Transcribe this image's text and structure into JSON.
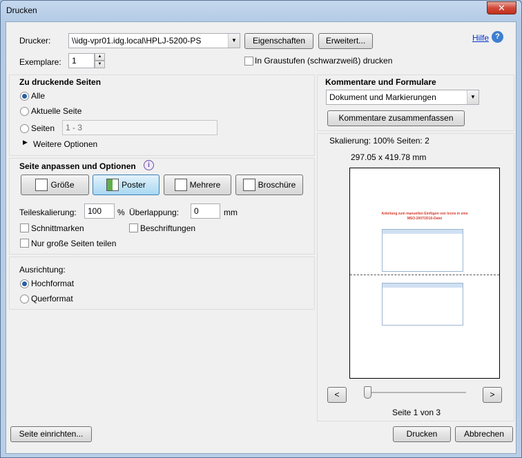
{
  "window": {
    "title": "Drucken",
    "close_label": "✕"
  },
  "printer": {
    "label": "Drucker:",
    "value": "\\\\idg-vpr01.idg.local\\HPLJ-5200-PS",
    "properties_button": "Eigenschaften",
    "advanced_button": "Erweitert...",
    "help_label": "Hilfe"
  },
  "copies": {
    "label": "Exemplare:",
    "value": "1"
  },
  "grayscale": {
    "label": "In Graustufen (schwarzweiß) drucken",
    "checked": false
  },
  "pages": {
    "title": "Zu druckende Seiten",
    "all": "Alle",
    "current": "Aktuelle Seite",
    "range": "Seiten",
    "range_placeholder": "1 - 3",
    "more_options": "Weitere Optionen"
  },
  "fit": {
    "title": "Seite anpassen und Optionen",
    "buttons": [
      "Größe",
      "Poster",
      "Mehrere",
      "Broschüre"
    ],
    "active": "Poster",
    "tile_scale_label": "Teileskalierung:",
    "tile_scale_value": "100",
    "tile_scale_unit": "%",
    "overlap_label": "Überlappung:",
    "overlap_value": "0",
    "overlap_unit": "mm",
    "cut_marks": "Schnittmarken",
    "labels": "Beschriftungen",
    "large_pages_only": "Nur große Seiten teilen"
  },
  "orientation": {
    "title": "Ausrichtung:",
    "portrait": "Hochformat",
    "landscape": "Querformat"
  },
  "comments": {
    "title": "Kommentare und Formulare",
    "select_value": "Dokument und Markierungen",
    "summarize_button": "Kommentare zusammenfassen"
  },
  "preview": {
    "scaling": "Skalierung: 100% Seiten: 2",
    "size": "297.05 x 419.78 mm",
    "doc_title_line1": "Anleitung zum manuellen Einfügen von Icons in eine",
    "doc_title_line2": "MSO-2007/2010-Datei",
    "prev": "<",
    "next": ">",
    "page_info": "Seite 1 von 3"
  },
  "footer": {
    "page_setup": "Seite einrichten...",
    "print": "Drucken",
    "cancel": "Abbrechen"
  },
  "colors": {
    "accent": "#2a5fa0",
    "title_red": "#d33a2c",
    "help_link": "#0033cc"
  }
}
